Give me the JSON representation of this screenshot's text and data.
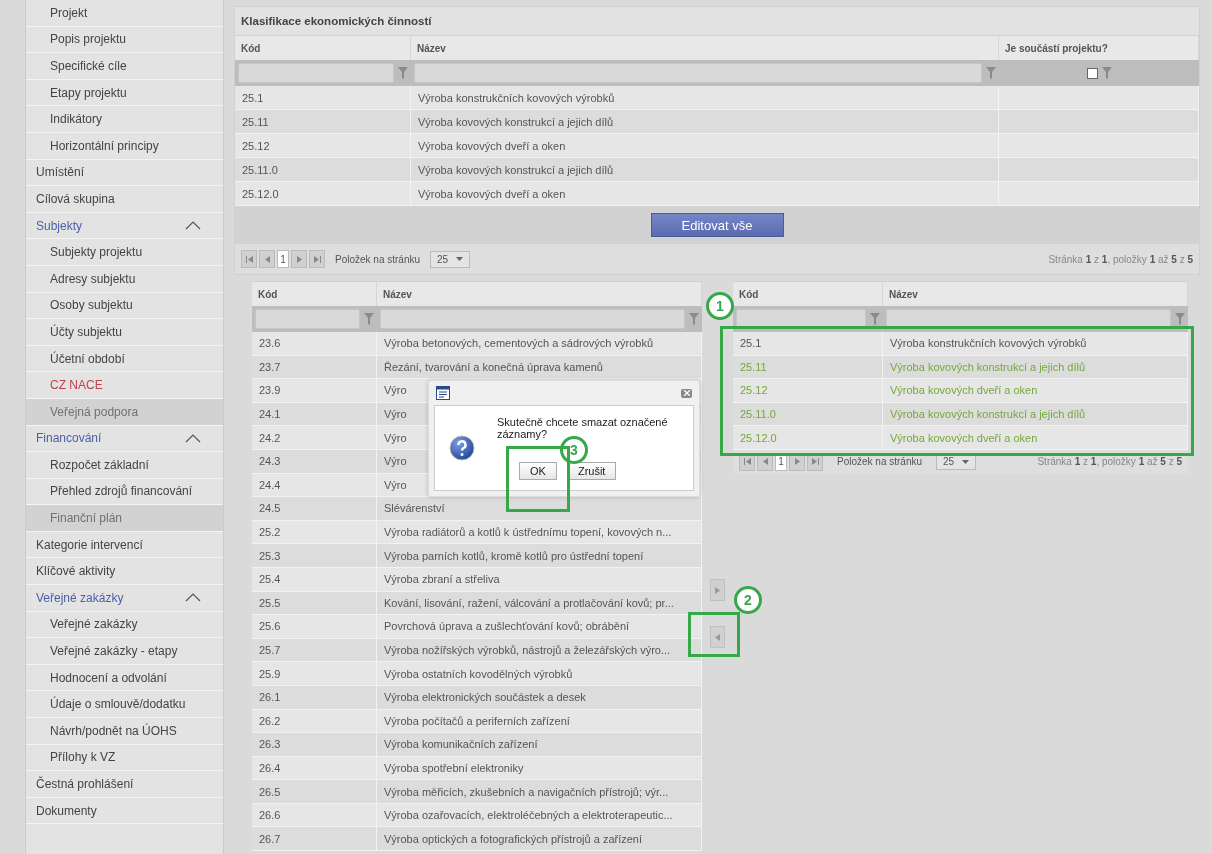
{
  "sidebar": {
    "items": [
      {
        "children": [
          {
            "label": "Projekt",
            "selected": false,
            "disabled": false
          },
          {
            "label": "Popis projektu",
            "selected": false,
            "disabled": false
          },
          {
            "label": "Specifické cíle",
            "selected": false,
            "disabled": false
          },
          {
            "label": "Etapy projektu",
            "selected": false,
            "disabled": false
          },
          {
            "label": "Indikátory",
            "selected": false,
            "disabled": false
          },
          {
            "label": "Horizontální principy",
            "selected": false,
            "disabled": false
          }
        ]
      },
      {
        "label": "Umístění",
        "selected": false
      },
      {
        "label": "Cílová skupina",
        "selected": false
      },
      {
        "label": "Subjekty",
        "selected": false,
        "expanded": true,
        "children": [
          {
            "label": "Subjekty projektu",
            "selected": false,
            "disabled": false
          },
          {
            "label": "Adresy subjektu",
            "selected": false,
            "disabled": false
          },
          {
            "label": "Osoby subjektu",
            "selected": false,
            "disabled": false
          },
          {
            "label": "Účty subjektu",
            "selected": false,
            "disabled": false
          },
          {
            "label": "Účetní období",
            "selected": false,
            "disabled": false
          },
          {
            "label": "CZ NACE",
            "selected": true,
            "disabled": false
          },
          {
            "label": "Veřejná podpora",
            "selected": false,
            "disabled": true
          }
        ]
      },
      {
        "label": "Financování",
        "selected": false,
        "expanded": true,
        "children": [
          {
            "label": "Rozpočet základní",
            "selected": false,
            "disabled": false
          },
          {
            "label": "Přehled zdrojů financování",
            "selected": false,
            "disabled": false
          },
          {
            "label": "Finanční plán",
            "selected": false,
            "disabled": true
          }
        ]
      },
      {
        "label": "Kategorie intervencí",
        "selected": false
      },
      {
        "label": "Klíčové aktivity",
        "selected": false
      },
      {
        "label": "Veřejné zakázky",
        "selected": false,
        "expanded": true,
        "children": [
          {
            "label": "Veřejné zakázky",
            "selected": false,
            "disabled": false
          },
          {
            "label": "Veřejné zakázky - etapy",
            "selected": false,
            "disabled": false
          },
          {
            "label": "Hodnocení a odvolání",
            "selected": false,
            "disabled": false
          },
          {
            "label": "Údaje o smlouvě/dodatku",
            "selected": false,
            "disabled": false
          },
          {
            "label": "Návrh/podnět na ÚOHS",
            "selected": false,
            "disabled": false
          },
          {
            "label": "Přílohy k VZ",
            "selected": false,
            "disabled": false
          }
        ]
      },
      {
        "label": "Čestná prohlášení",
        "selected": false
      },
      {
        "label": "Dokumenty",
        "selected": false
      }
    ]
  },
  "top_table": {
    "title": "Klasifikace ekonomických činností",
    "columns": [
      "Kód",
      "Název",
      "Je součástí projektu?"
    ],
    "filter_checked": false,
    "rows": [
      [
        "25.1",
        "Výroba konstrukčních kovových výrobků"
      ],
      [
        "25.11",
        "Výroba kovových konstrukcí a jejich dílů"
      ],
      [
        "25.12",
        "Výroba kovových dveří a oken"
      ],
      [
        "25.11.0",
        "Výroba kovových konstrukcí a jejich dílů"
      ],
      [
        "25.12.0",
        "Výroba kovových dveří a oken"
      ]
    ],
    "button": "Editovat vše",
    "pager": {
      "page": "1",
      "per_page_label": "Položek na stránku",
      "per_page": "25",
      "status": "Stránka **1** z **1**, položky **1** až **5** z **5**"
    }
  },
  "available_table": {
    "columns": [
      "Kód",
      "Název"
    ],
    "rows": [
      [
        "23.6",
        "Výroba betonových, cementových a sádrových výrobků"
      ],
      [
        "23.7",
        "Řezání, tvarování a konečná úprava kamenů"
      ],
      [
        "23.9",
        "Výro"
      ],
      [
        "24.1",
        "Výro"
      ],
      [
        "24.2",
        "Výro"
      ],
      [
        "24.3",
        "Výro"
      ],
      [
        "24.4",
        "Výro"
      ],
      [
        "24.5",
        "Slévárenství"
      ],
      [
        "25.2",
        "Výroba radiátorů a kotlů k ústřednímu topení, kovových n..."
      ],
      [
        "25.3",
        "Výroba parních kotlů, kromě kotlů pro ústřední topení"
      ],
      [
        "25.4",
        "Výroba zbraní a střeliva"
      ],
      [
        "25.5",
        "Kování, lisování, ražení, válcování a protlačování kovů; pr..."
      ],
      [
        "25.6",
        "Povrchová úprava a zušlechťování kovů; obrábění"
      ],
      [
        "25.7",
        "Výroba nožířských výrobků, nástrojů a železářských výro..."
      ],
      [
        "25.9",
        "Výroba ostatních kovodělných výrobků"
      ],
      [
        "26.1",
        "Výroba elektronických součástek a desek"
      ],
      [
        "26.2",
        "Výroba počítačů a periferních zařízení"
      ],
      [
        "26.3",
        "Výroba komunikačních zařízení"
      ],
      [
        "26.4",
        "Výroba spotřební elektroniky"
      ],
      [
        "26.5",
        "Výroba měřicích, zkušebních a navigačních přístrojů; výr..."
      ],
      [
        "26.6",
        "Výroba ozařovacích, elektroléčebných a elektroterapeutic..."
      ],
      [
        "26.7",
        "Výroba optických a fotografických přístrojů a zařízení"
      ]
    ]
  },
  "selected_table": {
    "columns": [
      "Kód",
      "Název"
    ],
    "rows": [
      {
        "code": "25.1",
        "name": "Výroba konstrukčních kovových výrobků",
        "selected": false
      },
      {
        "code": "25.11",
        "name": "Výroba kovových konstrukcí a jejich dílů",
        "selected": true
      },
      {
        "code": "25.12",
        "name": "Výroba kovových dveří a oken",
        "selected": true
      },
      {
        "code": "25.11.0",
        "name": "Výroba kovových konstrukcí a jejich dílů",
        "selected": true
      },
      {
        "code": "25.12.0",
        "name": "Výroba kovových dveří a oken",
        "selected": true
      }
    ],
    "pager": {
      "page": "1",
      "per_page_label": "Položek na stránku",
      "per_page": "25",
      "status": "Stránka **1** z **1**, položky **1** až **5** z **5**"
    }
  },
  "dialog": {
    "message": "Skutečně chcete smazat označené záznamy?",
    "buttons": [
      "OK",
      "Zrušit"
    ]
  },
  "annotations": [
    {
      "label": "1"
    },
    {
      "label": "2"
    },
    {
      "label": "3"
    }
  ]
}
